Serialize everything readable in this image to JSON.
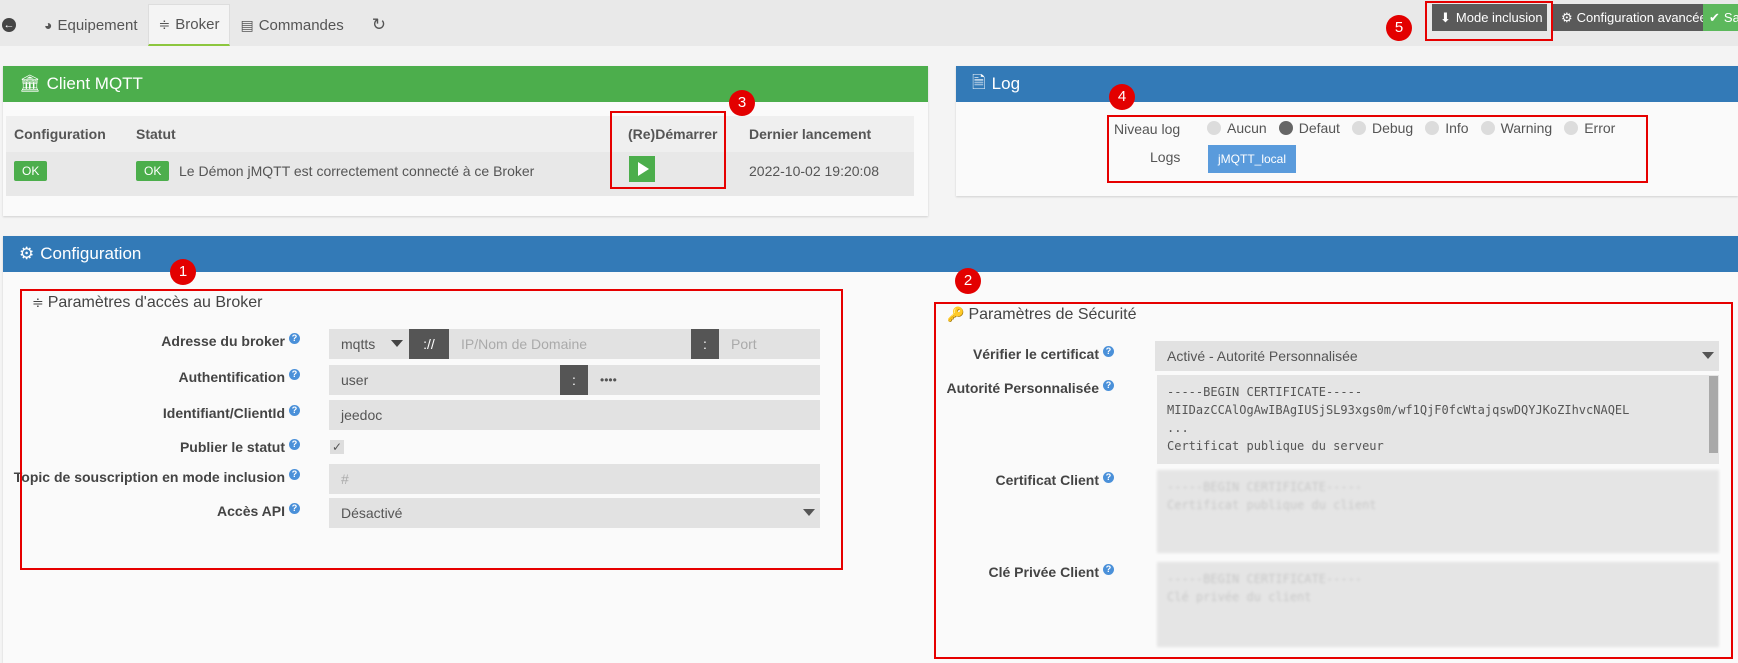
{
  "tabs": [
    {
      "label": "Equipement",
      "icon": "gauge-icon"
    },
    {
      "label": "Broker",
      "icon": "rss-icon"
    },
    {
      "label": "Commandes",
      "icon": "list-icon"
    }
  ],
  "top_buttons": {
    "inclusion": "Mode inclusion",
    "config_avancee": "Configuration avancée",
    "save": "Sa"
  },
  "mqtt": {
    "title": "Client MQTT",
    "headers": {
      "configuration": "Configuration",
      "statut": "Statut",
      "redemarrer": "(Re)Démarrer",
      "dernier": "Dernier lancement"
    },
    "config_badge": "OK",
    "statut_badge": "OK",
    "statut_text": "Le Démon jMQTT est correctement connecté à ce Broker",
    "dernier_lancement": "2022-10-02 19:20:08"
  },
  "log": {
    "title": "Log",
    "niveau_label": "Niveau log",
    "levels": [
      "Aucun",
      "Defaut",
      "Debug",
      "Info",
      "Warning",
      "Error"
    ],
    "selected_level": "Defaut",
    "logs_label": "Logs",
    "logs_button": "jMQTT_local"
  },
  "configuration": {
    "title": "Configuration",
    "acces": {
      "title": "Paramètres d'accès au Broker",
      "adresse_label": "Adresse du broker",
      "protocol": "mqtts",
      "sep_scheme": "://",
      "host_placeholder": "IP/Nom de Domaine",
      "sep_port": ":",
      "port_placeholder": "Port",
      "auth_label": "Authentification",
      "user": "user",
      "sep_auth": ":",
      "password": "••••",
      "client_id_label": "Identifiant/ClientId",
      "client_id": "jeedoc",
      "publier_label": "Publier le statut",
      "topic_label": "Topic de souscription en mode inclusion",
      "topic_placeholder": "#",
      "api_label": "Accès API",
      "api_value": "Désactivé"
    },
    "securite": {
      "title": "Paramètres de Sécurité",
      "verifier_label": "Vérifier le certificat",
      "verifier_value": "Activé - Autorité Personnalisée",
      "autorite_label": "Autorité Personnalisée",
      "autorite_text": "-----BEGIN CERTIFICATE-----\nMIIDazCCAlOgAwIBAgIUSjSL93xgs0m/wf1QjF0fcWtajqswDQYJKoZIhvcNAQEL\n...\nCertificat publique du serveur",
      "cert_client_label": "Certificat Client",
      "cert_client_text": "-----BEGIN CERTIFICATE-----\nCertificat publique du client",
      "cle_label": "Clé Privée Client",
      "cle_text": "-----BEGIN CERTIFICATE-----\nClé privée du client"
    }
  },
  "markers": [
    "1",
    "2",
    "3",
    "4",
    "5"
  ],
  "colors": {
    "green": "#4cae4c",
    "blue": "#337ab7",
    "annotation_red": "#e60000"
  }
}
